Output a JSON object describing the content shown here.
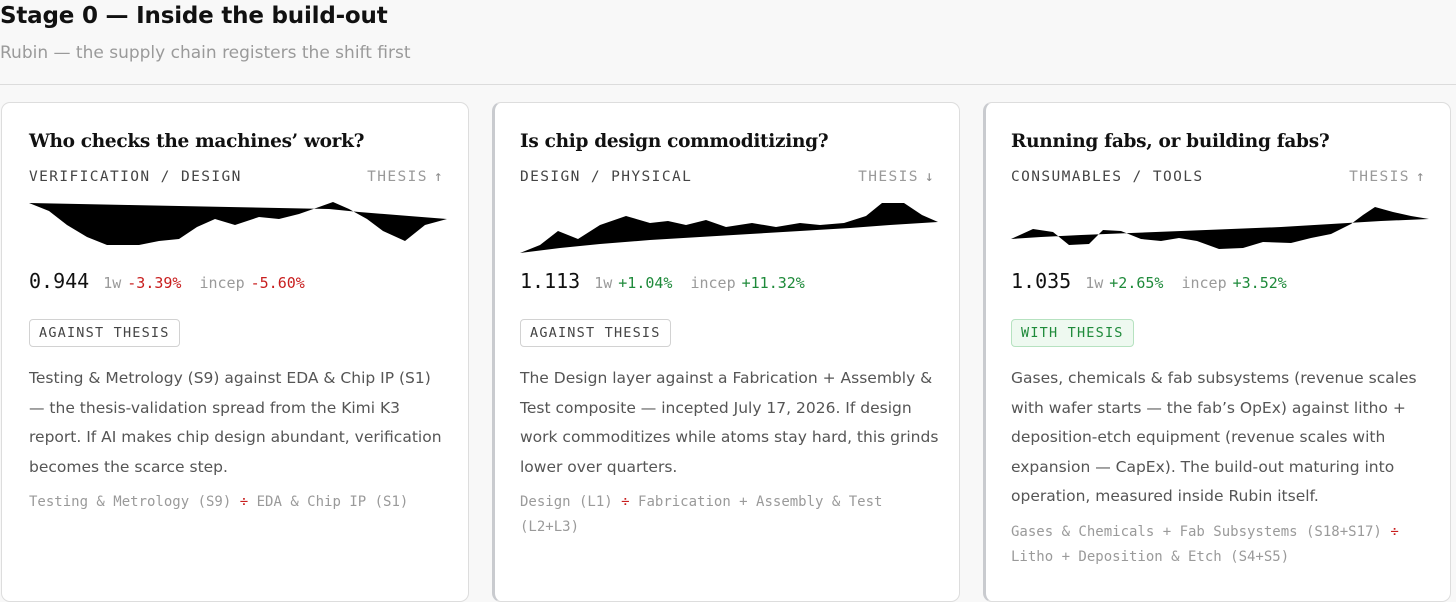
{
  "header": {
    "title": "Stage 0 — Inside the build-out",
    "subtitle": "Rubin — the supply chain registers the shift first"
  },
  "colors": {
    "negative": "#c81e1e",
    "positive": "#1e8a3a",
    "divider_symbol": "#c81e1e"
  },
  "cards": [
    {
      "title": "Who checks the machines’ work?",
      "category": "VERIFICATION / DESIGN",
      "thesis_label": "THESIS",
      "thesis_arrow": "↑",
      "thesis_arrow_icon": "arrow-up-icon",
      "value": "0.944",
      "week_label": "1w",
      "week_change": "-3.39%",
      "week_dir": "neg",
      "incep_label": "incep",
      "incep_change": "-5.60%",
      "incep_dir": "neg",
      "badge": "AGAINST THESIS",
      "badge_type": "against",
      "description": "Testing & Metrology (S9) against EDA & Chip IP (S1) — the thesis-validation spread from the Kimi K3 report. If AI makes chip design abundant, verification becomes the scarce step.",
      "formula_left": "Testing & Metrology (S9)",
      "formula_symbol": "÷",
      "formula_right": "EDA & Chip IP (S1)"
    },
    {
      "title": "Is chip design commoditizing?",
      "category": "DESIGN / PHYSICAL",
      "thesis_label": "THESIS",
      "thesis_arrow": "↓",
      "thesis_arrow_icon": "arrow-down-icon",
      "value": "1.113",
      "week_label": "1w",
      "week_change": "+1.04%",
      "week_dir": "pos",
      "incep_label": "incep",
      "incep_change": "+11.32%",
      "incep_dir": "pos",
      "badge": "AGAINST THESIS",
      "badge_type": "against",
      "description": "The Design layer against a Fabrication + Assembly & Test composite — incepted July 17, 2026. If design work commoditizes while atoms stay hard, this grinds lower over quarters.",
      "formula_left": "Design (L1)",
      "formula_symbol": "÷",
      "formula_right": "Fabrication + Assembly & Test (L2+L3)"
    },
    {
      "title": "Running fabs, or building fabs?",
      "category": "CONSUMABLES / TOOLS",
      "thesis_label": "THESIS",
      "thesis_arrow": "↑",
      "thesis_arrow_icon": "arrow-up-icon",
      "value": "1.035",
      "week_label": "1w",
      "week_change": "+2.65%",
      "week_dir": "pos",
      "incep_label": "incep",
      "incep_change": "+3.52%",
      "incep_dir": "pos",
      "badge": "WITH THESIS",
      "badge_type": "with",
      "description": "Gases, chemicals & fab subsystems (revenue scales with wafer starts — the fab’s OpEx) against litho + deposition-etch equipment (revenue scales with expansion — CapEx). The build-out maturing into operation, measured inside Rubin itself.",
      "formula_left": "Gases & Chemicals + Fab Subsystems (S18+S17)",
      "formula_symbol": "÷",
      "formula_right": "Litho + Deposition & Etch (S4+S5)"
    }
  ]
}
